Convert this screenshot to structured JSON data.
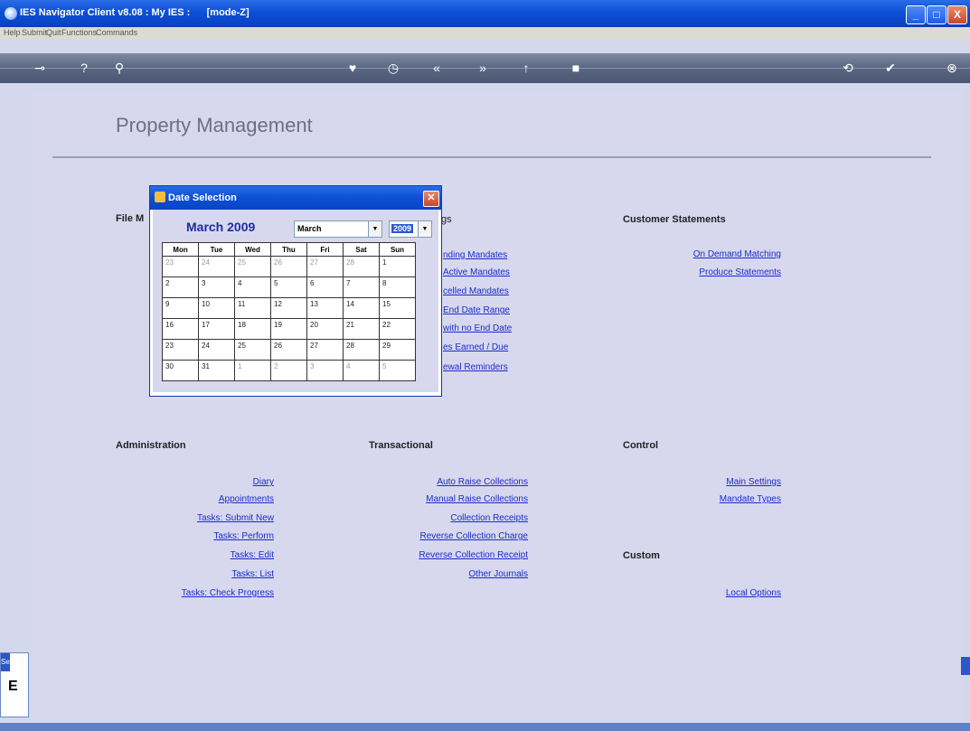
{
  "window": {
    "title": "IES Navigator Client v8.08 : My IES :",
    "mode": "[mode-Z]",
    "controls": [
      "_",
      "□",
      "X"
    ]
  },
  "menu": [
    "Help",
    "Submit",
    "Quit",
    "Functions",
    "Commands"
  ],
  "page": {
    "title": "Property Management"
  },
  "sections": {
    "file_management": {
      "title": "File M"
    },
    "mandates": {
      "title": "gs",
      "links": [
        "nding Mandates",
        "Active Mandates",
        "celled Mandates",
        "End Date Range",
        "with no End Date",
        "es Earned / Due",
        "ewal Reminders"
      ]
    },
    "customer_statements": {
      "title": "Customer Statements",
      "links": [
        "On Demand Matching",
        "Produce Statements"
      ]
    },
    "administration": {
      "title": "Administration",
      "links": [
        "Diary",
        "Appointments",
        "Tasks: Submit New",
        "Tasks: Perform",
        "Tasks: Edit",
        "Tasks: List",
        "Tasks: Check Progress"
      ]
    },
    "transactional": {
      "title": "Transactional",
      "links": [
        "Auto Raise Collections",
        "Manual Raise Collections",
        "Collection Receipts",
        "Reverse Collection Charge",
        "Reverse Collection Receipt",
        "Other Journals"
      ]
    },
    "control": {
      "title": "Control",
      "links": [
        "Main Settings",
        "Mandate Types"
      ]
    },
    "custom": {
      "title": "Custom",
      "links": [
        "Local Options"
      ]
    }
  },
  "date_dialog": {
    "title": "Date Selection",
    "month_title": "March 2009",
    "month_select": "March",
    "year_select": "2009",
    "weekdays": [
      "Mon",
      "Tue",
      "Wed",
      "Thu",
      "Fri",
      "Sat",
      "Sun"
    ],
    "weeks": [
      [
        {
          "d": "23",
          "o": true
        },
        {
          "d": "24",
          "o": true
        },
        {
          "d": "25",
          "o": true
        },
        {
          "d": "26",
          "o": true
        },
        {
          "d": "27",
          "o": true
        },
        {
          "d": "28",
          "o": true
        },
        {
          "d": "1",
          "o": false
        }
      ],
      [
        {
          "d": "2",
          "o": false
        },
        {
          "d": "3",
          "o": false
        },
        {
          "d": "4",
          "o": false
        },
        {
          "d": "5",
          "o": false
        },
        {
          "d": "6",
          "o": false
        },
        {
          "d": "7",
          "o": false
        },
        {
          "d": "8",
          "o": false
        }
      ],
      [
        {
          "d": "9",
          "o": false
        },
        {
          "d": "10",
          "o": false
        },
        {
          "d": "11",
          "o": false
        },
        {
          "d": "12",
          "o": false
        },
        {
          "d": "13",
          "o": false
        },
        {
          "d": "14",
          "o": false
        },
        {
          "d": "15",
          "o": false
        }
      ],
      [
        {
          "d": "16",
          "o": false
        },
        {
          "d": "17",
          "o": false
        },
        {
          "d": "18",
          "o": false
        },
        {
          "d": "19",
          "o": false
        },
        {
          "d": "20",
          "o": false
        },
        {
          "d": "21",
          "o": false
        },
        {
          "d": "22",
          "o": false
        }
      ],
      [
        {
          "d": "23",
          "o": false
        },
        {
          "d": "24",
          "o": false
        },
        {
          "d": "25",
          "o": false
        },
        {
          "d": "26",
          "o": false
        },
        {
          "d": "27",
          "o": false
        },
        {
          "d": "28",
          "o": false
        },
        {
          "d": "29",
          "o": false
        }
      ],
      [
        {
          "d": "30",
          "o": false
        },
        {
          "d": "31",
          "o": false
        },
        {
          "d": "1",
          "o": true
        },
        {
          "d": "2",
          "o": true
        },
        {
          "d": "3",
          "o": true
        },
        {
          "d": "4",
          "o": true
        },
        {
          "d": "5",
          "o": true
        }
      ]
    ]
  },
  "toolbar_icons": [
    "key-icon",
    "help-icon",
    "search-icon",
    "heart-icon",
    "clock-icon",
    "rewind-icon",
    "fast-forward-icon",
    "up-icon",
    "stop-icon",
    "refresh-icon",
    "check-icon",
    "close-icon"
  ],
  "side_box": {
    "label": "Se",
    "char": "E"
  }
}
